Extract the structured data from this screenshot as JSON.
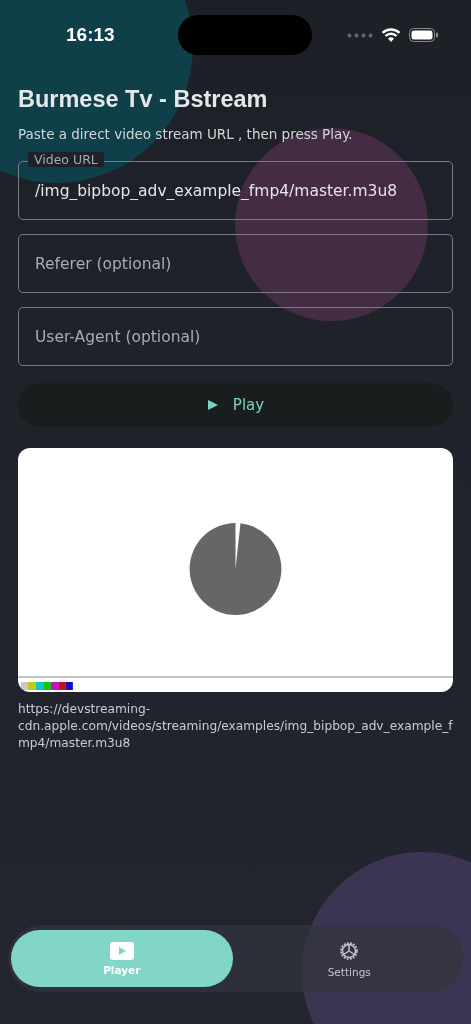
{
  "status_bar": {
    "time": "16:13"
  },
  "title": "Burmese Tv - Bstream",
  "subtitle": "Paste a direct video stream URL , then press Play.",
  "fields": [
    {
      "label": "Video URL",
      "value": "/img_bipbop_adv_example_fmp4/master.m3u8"
    },
    {
      "placeholder": "Referer (optional)"
    },
    {
      "placeholder": "User-Agent (optional)"
    }
  ],
  "play_button": {
    "label": "Play"
  },
  "stream_url": "https://devstreaming-cdn.apple.com/videos/streaming/examples/img_bipbop_adv_example_fmp4/master.m3u8",
  "tab_bar": {
    "tabs": [
      {
        "label": "Player",
        "kind": "player",
        "selected": true
      },
      {
        "label": "Settings",
        "kind": "settings",
        "selected": false
      }
    ]
  }
}
